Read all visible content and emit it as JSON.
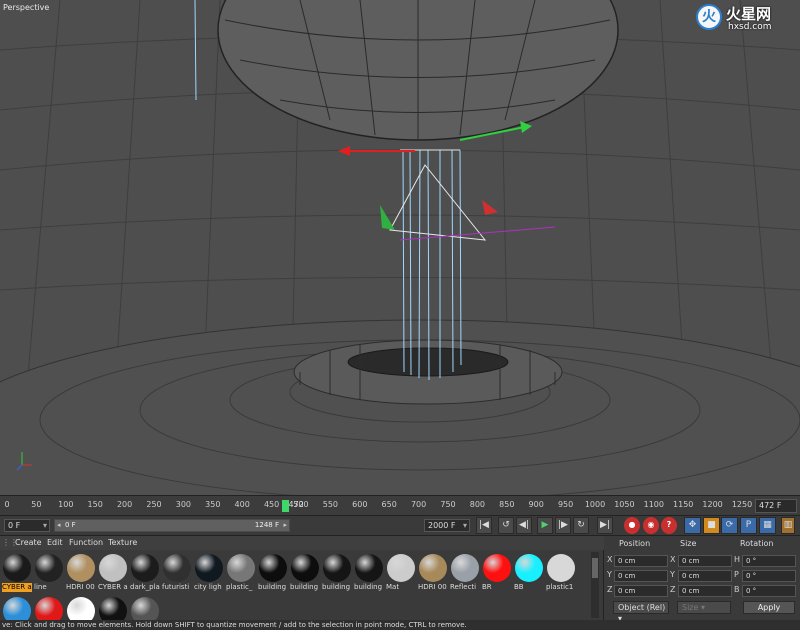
{
  "viewport": {
    "label": "Perspective"
  },
  "logo": {
    "glyph": "火",
    "title": "火星网",
    "domain": "hxsd.com"
  },
  "timeline": {
    "ticks": [
      "0",
      "50",
      "100",
      "150",
      "200",
      "250",
      "300",
      "350",
      "400",
      "450",
      "500",
      "550",
      "600",
      "650",
      "700",
      "750",
      "800",
      "850",
      "900",
      "950",
      "1000",
      "1050",
      "1100",
      "1150",
      "1200",
      "1250"
    ],
    "playhead_label": "472",
    "frame_display": "472 F",
    "playhead_frame": 472,
    "max_frame": 1250
  },
  "transport": {
    "start_field": "0 F",
    "slider_start": "0 F",
    "slider_end": "1248 F",
    "end_field": "2000 F"
  },
  "materials": {
    "menu": [
      "Create",
      "Edit",
      "Function",
      "Texture"
    ],
    "row1": [
      {
        "label": "CYBER a",
        "color": "#1a1a1a",
        "selected": true
      },
      {
        "label": "line",
        "color": "#222222"
      },
      {
        "label": "HDRI 00",
        "color": "#b09060"
      },
      {
        "label": "CYBER a",
        "color": "#c0c0c0"
      },
      {
        "label": "dark_pla",
        "color": "#1c1c1c"
      },
      {
        "label": "futuristi",
        "color": "#303030"
      },
      {
        "label": "city ligh",
        "color": "#101820"
      },
      {
        "label": "plastic_",
        "color": "#777777"
      },
      {
        "label": "building",
        "color": "#0d0d0d"
      },
      {
        "label": "building",
        "color": "#0d0d0d"
      },
      {
        "label": "building",
        "color": "#151515"
      },
      {
        "label": "building",
        "color": "#151515"
      },
      {
        "label": "Mat",
        "color": "#cccccc"
      },
      {
        "label": "HDRI 00",
        "color": "#a88a5a"
      },
      {
        "label": "Reflecti",
        "color": "#9aa0a8"
      },
      {
        "label": "BR",
        "color": "#ff1010"
      },
      {
        "label": "BB",
        "color": "#19f0ff"
      },
      {
        "label": "plastic1",
        "color": "#d8d8d8"
      }
    ],
    "row2": [
      {
        "color": "#2d8fd8"
      },
      {
        "color": "#e01818"
      },
      {
        "color": "#ffffff"
      },
      {
        "color": "#111111"
      },
      {
        "color": "#555555"
      }
    ]
  },
  "coords": {
    "headers": [
      "Position",
      "Size",
      "Rotation"
    ],
    "rows": [
      {
        "axis": "X",
        "pos": "0 cm",
        "size_axis": "X",
        "size": "0 cm",
        "rot_axis": "H",
        "rot": "0 °"
      },
      {
        "axis": "Y",
        "pos": "0 cm",
        "size_axis": "Y",
        "size": "0 cm",
        "rot_axis": "P",
        "rot": "0 °"
      },
      {
        "axis": "Z",
        "pos": "0 cm",
        "size_axis": "Z",
        "size": "0 cm",
        "rot_axis": "B",
        "rot": "0 °"
      }
    ],
    "mode": "Object (Rel)",
    "size_mode": "Size",
    "apply": "Apply"
  },
  "status": "ve: Click and drag to move elements. Hold down SHIFT to quantize movement / add to the selection in point mode, CTRL to remove."
}
